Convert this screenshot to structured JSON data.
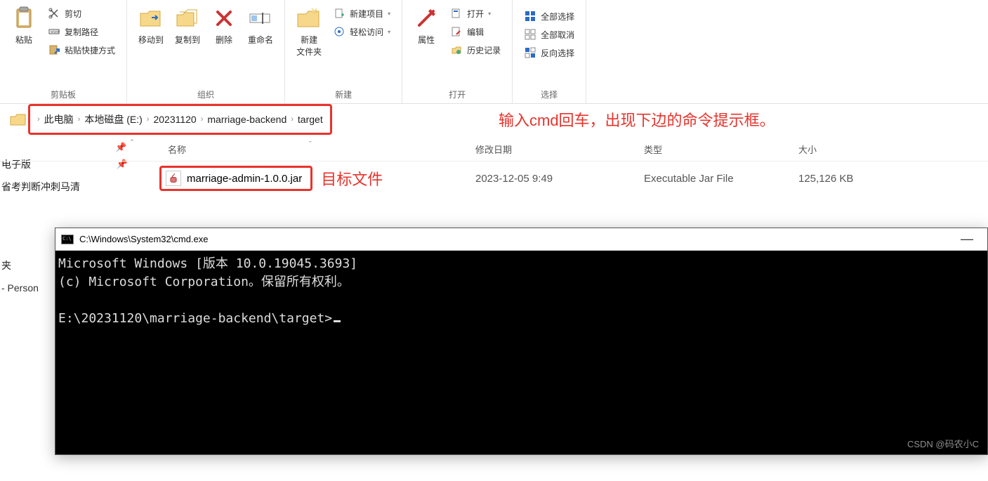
{
  "ribbon": {
    "clipboard": {
      "label": "剪贴板",
      "paste": "粘贴",
      "cut": "剪切",
      "copy_path": "复制路径",
      "paste_shortcut": "粘贴快捷方式"
    },
    "organize": {
      "label": "组织",
      "move_to": "移动到",
      "copy_to": "复制到",
      "delete": "删除",
      "rename": "重命名"
    },
    "new": {
      "label": "新建",
      "new_folder": "新建\n文件夹",
      "new_item": "新建项目",
      "easy_access": "轻松访问"
    },
    "open": {
      "label": "打开",
      "properties": "属性",
      "open": "打开",
      "edit": "编辑",
      "history": "历史记录"
    },
    "select": {
      "label": "选择",
      "select_all": "全部选择",
      "select_none": "全部取消",
      "invert": "反向选择"
    }
  },
  "breadcrumbs": {
    "items": [
      "此电脑",
      "本地磁盘 (E:)",
      "20231120",
      "marriage-backend",
      "target"
    ]
  },
  "annotations": {
    "address_tip": "输入cmd回车，出现下边的命令提示框。",
    "target_file": "目标文件"
  },
  "columns": {
    "name": "名称",
    "date": "修改日期",
    "type": "类型",
    "size": "大小"
  },
  "file": {
    "name": "marriage-admin-1.0.0.jar",
    "date": "2023-12-05 9:49",
    "type": "Executable Jar File",
    "size": "125,126 KB"
  },
  "quick_access": {
    "item1": "电子版",
    "item2": "省考判断冲刺马清",
    "empty": "夹",
    "personal": " - Person"
  },
  "cmd": {
    "title": "C:\\Windows\\System32\\cmd.exe",
    "line1": "Microsoft Windows [版本 10.0.19045.3693]",
    "line2": "(c) Microsoft Corporation。保留所有权利。",
    "prompt": "E:\\20231120\\marriage-backend\\target>"
  },
  "watermark": "CSDN @码农小C"
}
